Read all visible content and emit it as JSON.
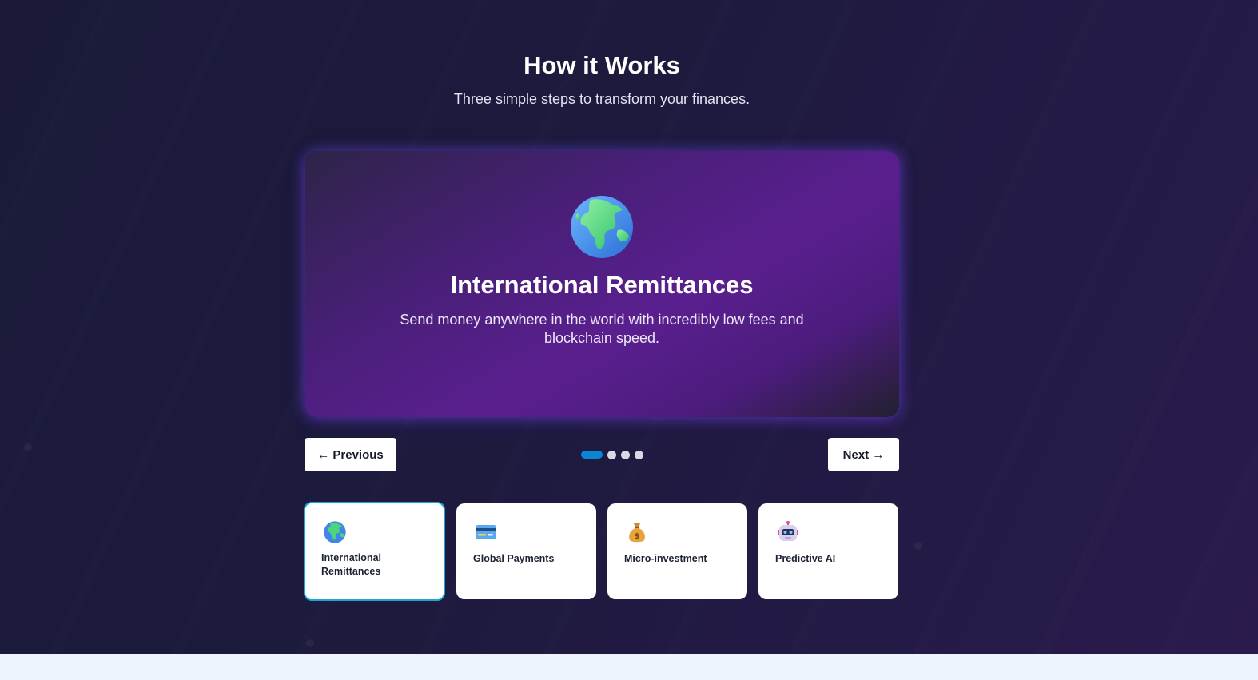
{
  "section": {
    "title": "How it Works",
    "subtitle": "Three simple steps to transform your finances."
  },
  "hero": {
    "icon": "globe-icon",
    "title": "International Remittances",
    "description": "Send money anywhere in the world with incredibly low fees and blockchain speed."
  },
  "navigation": {
    "previous_label": "← Previous",
    "next_label": "Next →",
    "slide_count": 4,
    "active_slide": 1
  },
  "features": [
    {
      "label": "International Remittances",
      "icon": "globe-icon",
      "active": true
    },
    {
      "label": "Global Payments",
      "icon": "credit-card-icon",
      "active": false
    },
    {
      "label": "Micro-investment",
      "icon": "money-bag-icon",
      "active": false
    },
    {
      "label": "Predictive AI",
      "icon": "robot-icon",
      "active": false
    }
  ],
  "colors": {
    "accent": "#0b86d4",
    "active_border": "#1aa6d6",
    "hero_purple": "#5a1f8f",
    "background": "#1d1a3e"
  }
}
